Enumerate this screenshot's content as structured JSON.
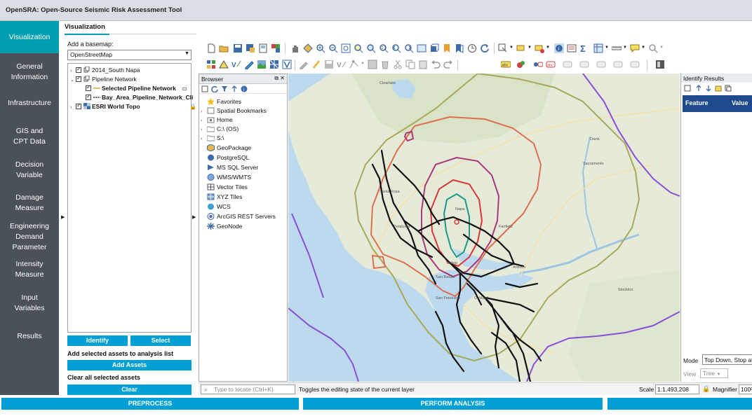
{
  "app": {
    "title": "OpenSRA: Open-Source Seismic Risk Assessment Tool"
  },
  "colors": {
    "accent": "#00a0b0",
    "button": "#00a0d6",
    "nav_bg": "#4b5158",
    "identify_header": "#1c4a8c"
  },
  "nav": {
    "items": [
      {
        "label": "Visualization",
        "active": true
      },
      {
        "label": "General Information"
      },
      {
        "label": "Infrastructure"
      },
      {
        "label": "GIS and CPT Data"
      },
      {
        "label": "Decision Variable"
      },
      {
        "label": "Damage Measure"
      },
      {
        "label": "Engineering Demand Parameter"
      },
      {
        "label": "Intensity Measure"
      },
      {
        "label": "Input Variables"
      },
      {
        "label": "Results"
      }
    ]
  },
  "visualization": {
    "tab_label": "Visualization",
    "basemap_label": "Add a basemap:",
    "basemap_value": "OpenStreetMap",
    "layers": [
      {
        "label": "2014_South Napa",
        "checked": true,
        "icon": "group-icon"
      },
      {
        "label": "Pipeline Network",
        "checked": true,
        "icon": "group-icon"
      },
      {
        "label": "Selected Pipeline Network",
        "checked": true,
        "icon": "line-icon"
      },
      {
        "label": "Bay_Area_Pipeline_Network_Cli",
        "checked": true,
        "icon": "line-icon"
      },
      {
        "label": "ESRI World Topo",
        "checked": true,
        "icon": "raster-icon"
      }
    ],
    "identify_label": "Identify",
    "select_label": "Select",
    "add_assets_text": "Add selected assets to analysis list",
    "add_assets_button": "Add Assets",
    "clear_text": "Clear all selected assets",
    "clear_button": "Clear"
  },
  "browser": {
    "title": "Browser",
    "items": [
      {
        "label": "Favorites",
        "icon": "star-icon"
      },
      {
        "label": "Spatial Bookmarks",
        "icon": "bookmark-icon"
      },
      {
        "label": "Home",
        "icon": "home-icon"
      },
      {
        "label": "C:\\ (OS)",
        "icon": "drive-icon"
      },
      {
        "label": "S:\\",
        "icon": "drive-icon"
      },
      {
        "label": "GeoPackage",
        "icon": "geopackage-icon"
      },
      {
        "label": "PostgreSQL",
        "icon": "postgresql-icon"
      },
      {
        "label": "MS SQL Server",
        "icon": "mssql-icon"
      },
      {
        "label": "WMS/WMTS",
        "icon": "wms-icon"
      },
      {
        "label": "Vector Tiles",
        "icon": "vector-tiles-icon"
      },
      {
        "label": "XYZ Tiles",
        "icon": "xyz-tiles-icon"
      },
      {
        "label": "WCS",
        "icon": "wcs-icon"
      },
      {
        "label": "ArcGIS REST Servers",
        "icon": "arcgis-icon"
      },
      {
        "label": "GeoNode",
        "icon": "geonode-icon"
      }
    ]
  },
  "identify": {
    "title": "Identify Results",
    "col_feature": "Feature",
    "col_value": "Value",
    "mode_label": "Mode",
    "mode_value": "Top Down, Stop at First",
    "view_label": "View",
    "view_value": "Tree"
  },
  "map": {
    "place_labels": [
      "Clearlake",
      "Sacramento",
      "Napa",
      "Fairfield",
      "Santa Rosa",
      "Vallejo",
      "Antioch",
      "Oakland",
      "San Francisco",
      "San Rafael",
      "Petaluma",
      "Davis",
      "Stockton"
    ]
  },
  "status": {
    "locate_placeholder": "Type to locate (Ctrl+K)",
    "message": "Toggles the editing state of the current layer",
    "scale_label": "Scale",
    "scale_value": "1:1,493,208",
    "magnifier_label": "Magnifier",
    "magnifier_value": "100%"
  },
  "bottom": {
    "preprocess": "PREPROCESS",
    "perform_analysis": "PERFORM ANALYSIS"
  }
}
